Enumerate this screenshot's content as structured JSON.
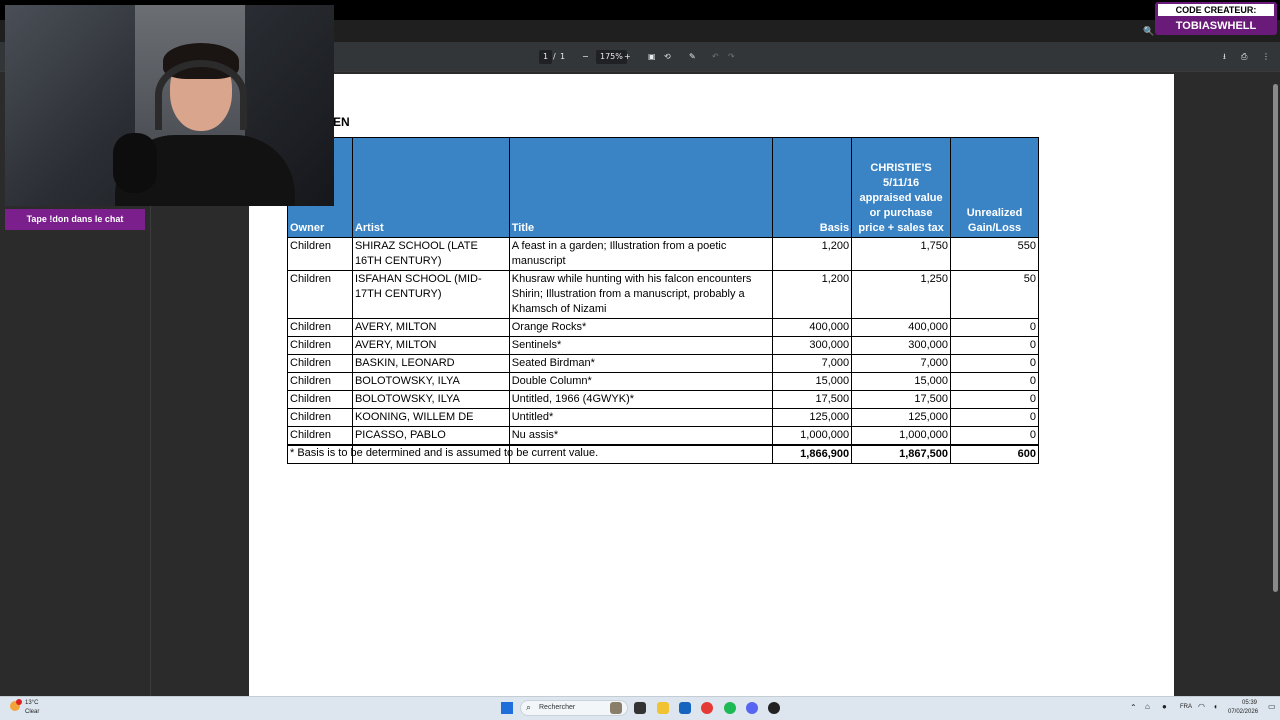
{
  "pdf_toolbar": {
    "page_current": "1",
    "page_separator": "/",
    "page_total": "1",
    "zoom_out": "−",
    "zoom_level": "175%",
    "zoom_in": "+",
    "fit_icon": "fit-page-icon",
    "rotate_icon": "rotate-icon",
    "annotate_icon": "annotate-icon",
    "undo_icon": "undo-icon",
    "redo_icon": "redo-icon",
    "download_icon": "download-icon",
    "print_icon": "print-icon",
    "menu_icon": "more-icon"
  },
  "document": {
    "heading_fragment": "EN",
    "table": {
      "headers": {
        "owner": "Owner",
        "artist": "Artist",
        "title": "Title",
        "basis": "Basis",
        "appraised": [
          "CHRISTIE'S",
          "5/11/16",
          "appraised value",
          "or purchase",
          "price + sales tax"
        ],
        "gain": [
          "Unrealized",
          "Gain/Loss"
        ]
      },
      "rows": [
        {
          "owner": "Children",
          "artist": "SHIRAZ SCHOOL (LATE 16TH CENTURY)",
          "title": "A feast in a garden; Illustration from a poetic manuscript",
          "basis": "1,200",
          "appraised": "1,750",
          "gain": "550"
        },
        {
          "owner": "Children",
          "artist": "ISFAHAN SCHOOL (MID-17TH CENTURY)",
          "title": "Khusraw while hunting with his falcon encounters Shirin; Illustration from a manuscript, probably a Khamsch of Nizami",
          "basis": "1,200",
          "appraised": "1,250",
          "gain": "50"
        },
        {
          "owner": "Children",
          "artist": "AVERY, MILTON",
          "title": "Orange Rocks*",
          "basis": "400,000",
          "appraised": "400,000",
          "gain": "0"
        },
        {
          "owner": "Children",
          "artist": "AVERY, MILTON",
          "title": "Sentinels*",
          "basis": "300,000",
          "appraised": "300,000",
          "gain": "0"
        },
        {
          "owner": "Children",
          "artist": "BASKIN, LEONARD",
          "title": "Seated Birdman*",
          "basis": "7,000",
          "appraised": "7,000",
          "gain": "0"
        },
        {
          "owner": "Children",
          "artist": "BOLOTOWSKY, ILYA",
          "title": "Double Column*",
          "basis": "15,000",
          "appraised": "15,000",
          "gain": "0"
        },
        {
          "owner": "Children",
          "artist": "BOLOTOWSKY, ILYA",
          "title": "Untitled, 1966 (4GWYK)*",
          "basis": "17,500",
          "appraised": "17,500",
          "gain": "0"
        },
        {
          "owner": "Children",
          "artist": "KOONING, WILLEM DE",
          "title": "Untitled*",
          "basis": "125,000",
          "appraised": "125,000",
          "gain": "0"
        },
        {
          "owner": "Children",
          "artist": "PICASSO, PABLO",
          "title": "Nu assis*",
          "basis": "1,000,000",
          "appraised": "1,000,000",
          "gain": "0"
        }
      ],
      "totals": {
        "basis": "1,866,900",
        "appraised": "1,867,500",
        "gain": "600"
      },
      "header_color": "#3a84c6"
    },
    "footnote": "* Basis is to be determined and is assumed to be current value."
  },
  "overlay": {
    "chat_tag": "Tape !don dans le chat",
    "creator_line1": "CODE CREATEUR:",
    "creator_line2": "TOBIASWHELL",
    "accent_color": "#7a1f8c"
  },
  "taskbar": {
    "weather_temp": "13°C",
    "weather_desc": "Clear",
    "search_placeholder": "Rechercher",
    "language": "FRA",
    "time": "05:39",
    "date": "07/02/2026"
  }
}
